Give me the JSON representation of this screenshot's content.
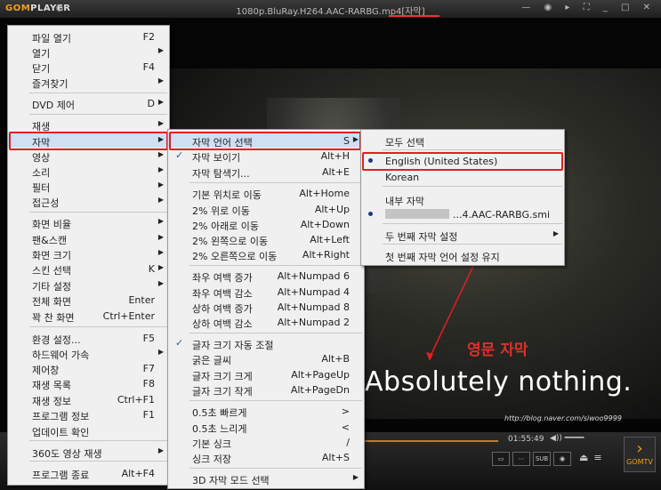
{
  "window": {
    "app_name_prefix": "GOM",
    "app_name_suffix": "PLAYER",
    "title": "1080p.BluRay.H264.AAC-RARBG.mp4[자막]"
  },
  "video": {
    "subtitle_text": "Absolutely nothing.",
    "annotation_label": "영문 자막",
    "watermark": "http://blog.naver.com/siwoo9999"
  },
  "controls": {
    "timecode": "01:55:49",
    "sub_label": "SUB",
    "gomtv_label": "GOMTV"
  },
  "main_menu": {
    "items": [
      {
        "label": "파일 열기",
        "shortcut": "F2",
        "arrow": ""
      },
      {
        "label": "열기",
        "shortcut": "",
        "arrow": "▶"
      },
      {
        "label": "닫기",
        "shortcut": "F4",
        "arrow": ""
      },
      {
        "label": "즐겨찾기",
        "shortcut": "",
        "arrow": "▶"
      },
      {
        "label": "DVD 제어",
        "shortcut": "D",
        "arrow": "▶"
      },
      {
        "label": "재생",
        "shortcut": "",
        "arrow": "▶"
      },
      {
        "label": "자막",
        "shortcut": "",
        "arrow": "▶"
      },
      {
        "label": "영상",
        "shortcut": "",
        "arrow": "▶"
      },
      {
        "label": "소리",
        "shortcut": "",
        "arrow": "▶"
      },
      {
        "label": "필터",
        "shortcut": "",
        "arrow": "▶"
      },
      {
        "label": "접근성",
        "shortcut": "",
        "arrow": "▶"
      },
      {
        "label": "화면 비율",
        "shortcut": "",
        "arrow": "▶"
      },
      {
        "label": "팬&스캔",
        "shortcut": "",
        "arrow": "▶"
      },
      {
        "label": "화면 크기",
        "shortcut": "",
        "arrow": "▶"
      },
      {
        "label": "스킨 선택",
        "shortcut": "K",
        "arrow": "▶"
      },
      {
        "label": "기타 설정",
        "shortcut": "",
        "arrow": "▶"
      },
      {
        "label": "전체 화면",
        "shortcut": "Enter",
        "arrow": ""
      },
      {
        "label": "꽉 찬 화면",
        "shortcut": "Ctrl+Enter",
        "arrow": ""
      },
      {
        "label": "환경 설정...",
        "shortcut": "F5",
        "arrow": ""
      },
      {
        "label": "하드웨어 가속",
        "shortcut": "",
        "arrow": "▶"
      },
      {
        "label": "제어창",
        "shortcut": "F7",
        "arrow": ""
      },
      {
        "label": "재생 목록",
        "shortcut": "F8",
        "arrow": ""
      },
      {
        "label": "재생 정보",
        "shortcut": "Ctrl+F1",
        "arrow": ""
      },
      {
        "label": "프로그램 정보",
        "shortcut": "F1",
        "arrow": ""
      },
      {
        "label": "업데이트 확인",
        "shortcut": "",
        "arrow": ""
      },
      {
        "label": "360도 영상 재생",
        "shortcut": "",
        "arrow": "▶"
      },
      {
        "label": "프로그램 종료",
        "shortcut": "Alt+F4",
        "arrow": ""
      }
    ]
  },
  "subtitle_menu": {
    "items": [
      {
        "label": "자막 언어 선택",
        "shortcut": "S",
        "arrow": "▶"
      },
      {
        "label": "자막 보이기",
        "shortcut": "Alt+H",
        "arrow": ""
      },
      {
        "label": "자막 탐색기...",
        "shortcut": "Alt+E",
        "arrow": ""
      },
      {
        "label": "기본 위치로 이동",
        "shortcut": "Alt+Home",
        "arrow": ""
      },
      {
        "label": "2% 위로 이동",
        "shortcut": "Alt+Up",
        "arrow": ""
      },
      {
        "label": "2% 아래로 이동",
        "shortcut": "Alt+Down",
        "arrow": ""
      },
      {
        "label": "2% 왼쪽으로 이동",
        "shortcut": "Alt+Left",
        "arrow": ""
      },
      {
        "label": "2% 오른쪽으로 이동",
        "shortcut": "Alt+Right",
        "arrow": ""
      },
      {
        "label": "좌우 여백 증가",
        "shortcut": "Alt+Numpad 6",
        "arrow": ""
      },
      {
        "label": "좌우 여백 감소",
        "shortcut": "Alt+Numpad 4",
        "arrow": ""
      },
      {
        "label": "상하 여백 증가",
        "shortcut": "Alt+Numpad 8",
        "arrow": ""
      },
      {
        "label": "상하 여백 감소",
        "shortcut": "Alt+Numpad 2",
        "arrow": ""
      },
      {
        "label": "글자 크기 자동 조절",
        "shortcut": "",
        "arrow": ""
      },
      {
        "label": "굵은 글씨",
        "shortcut": "Alt+B",
        "arrow": ""
      },
      {
        "label": "글자 크기 크게",
        "shortcut": "Alt+PageUp",
        "arrow": ""
      },
      {
        "label": "글자 크기 작게",
        "shortcut": "Alt+PageDn",
        "arrow": ""
      },
      {
        "label": "0.5초 빠르게",
        "shortcut": ">",
        "arrow": ""
      },
      {
        "label": "0.5초 느리게",
        "shortcut": "<",
        "arrow": ""
      },
      {
        "label": "기본 싱크",
        "shortcut": "/",
        "arrow": ""
      },
      {
        "label": "싱크 저장",
        "shortcut": "Alt+S",
        "arrow": ""
      },
      {
        "label": "3D 자막 모드 선택",
        "shortcut": "",
        "arrow": "▶"
      }
    ]
  },
  "language_menu": {
    "items": [
      {
        "label": "모두 선택",
        "arrow": ""
      },
      {
        "label": "English (United States)",
        "arrow": ""
      },
      {
        "label": "Korean",
        "arrow": ""
      },
      {
        "label": "내부 자막",
        "arrow": ""
      },
      {
        "label": "...4.AAC-RARBG.smi",
        "arrow": ""
      },
      {
        "label": "두 번째 자막 설정",
        "arrow": "▶"
      },
      {
        "label": "첫 번째 자막 언어 설정 유지",
        "arrow": ""
      }
    ]
  }
}
